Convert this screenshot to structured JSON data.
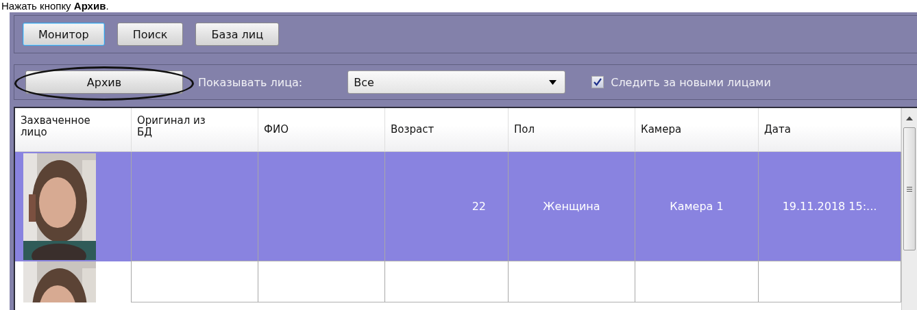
{
  "caption": "Нажать кнопку **Архив**.",
  "nav_buttons": [
    {
      "label": "Монитор",
      "selected": true
    },
    {
      "label": "Поиск",
      "selected": false
    },
    {
      "label": "База лиц",
      "selected": false
    }
  ],
  "toolbar": {
    "archive_button": {
      "label": "Архив",
      "highlighted": true
    },
    "show_faces_label": "Показывать лица:",
    "show_faces_select": {
      "value": "Все"
    },
    "follow_checkbox": {
      "label": "Следить за новыми лицами",
      "checked": true
    }
  },
  "table": {
    "columns": [
      "Захваченное\nлицо",
      "Оригинал из\nБД",
      "ФИО",
      "Возраст",
      "Пол",
      "Камера",
      "Дата"
    ],
    "rows": [
      {
        "selected": true,
        "photo": {
          "kind": "picture"
        },
        "cells": [
          "",
          "",
          "22",
          "Женщина",
          "Камера 1",
          "19.11.2018 15:..."
        ]
      },
      {
        "selected": false,
        "photo": {
          "kind": "picture"
        },
        "cells": [
          "",
          "",
          "",
          "",
          "",
          ""
        ]
      }
    ]
  }
}
